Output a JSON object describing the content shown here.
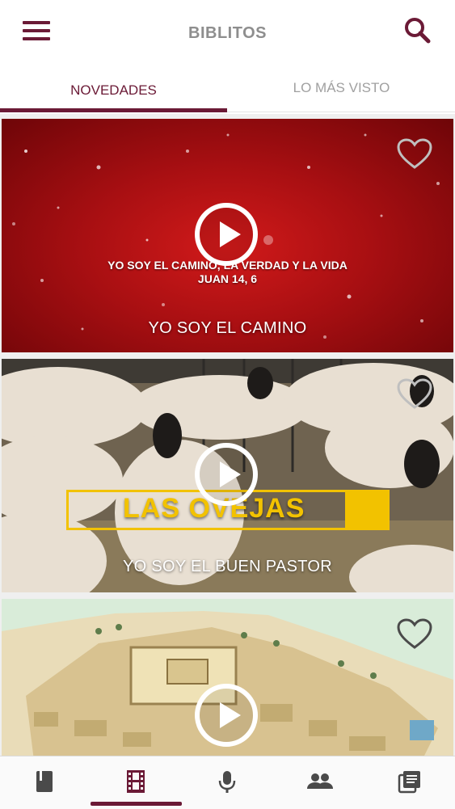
{
  "app": {
    "title": "BIBLITOS"
  },
  "header": {
    "menu_icon": "hamburger-menu-icon",
    "search_icon": "search-icon"
  },
  "tabs": [
    {
      "label": "NOVEDADES",
      "active": true
    },
    {
      "label": "LO MÁS VISTO",
      "active": false
    }
  ],
  "videos": [
    {
      "title": "YO SOY EL CAMINO",
      "overlay_line1": "YO SOY EL CAMINO, LA VERDAD Y LA VIDA",
      "overlay_line2": "JUAN 14, 6"
    },
    {
      "title": "YO SOY EL BUEN PASTOR",
      "banner_text": "LAS OVEJAS"
    },
    {
      "title": ""
    }
  ],
  "bottom_nav": [
    {
      "icon": "book-icon",
      "active": false
    },
    {
      "icon": "film-icon",
      "active": true
    },
    {
      "icon": "microphone-icon",
      "active": false
    },
    {
      "icon": "people-icon",
      "active": false
    },
    {
      "icon": "library-icon",
      "active": false
    }
  ],
  "colors": {
    "accent": "#6b1a36",
    "title_gray": "#8e8e8e",
    "banner_yellow": "#f2c200"
  }
}
